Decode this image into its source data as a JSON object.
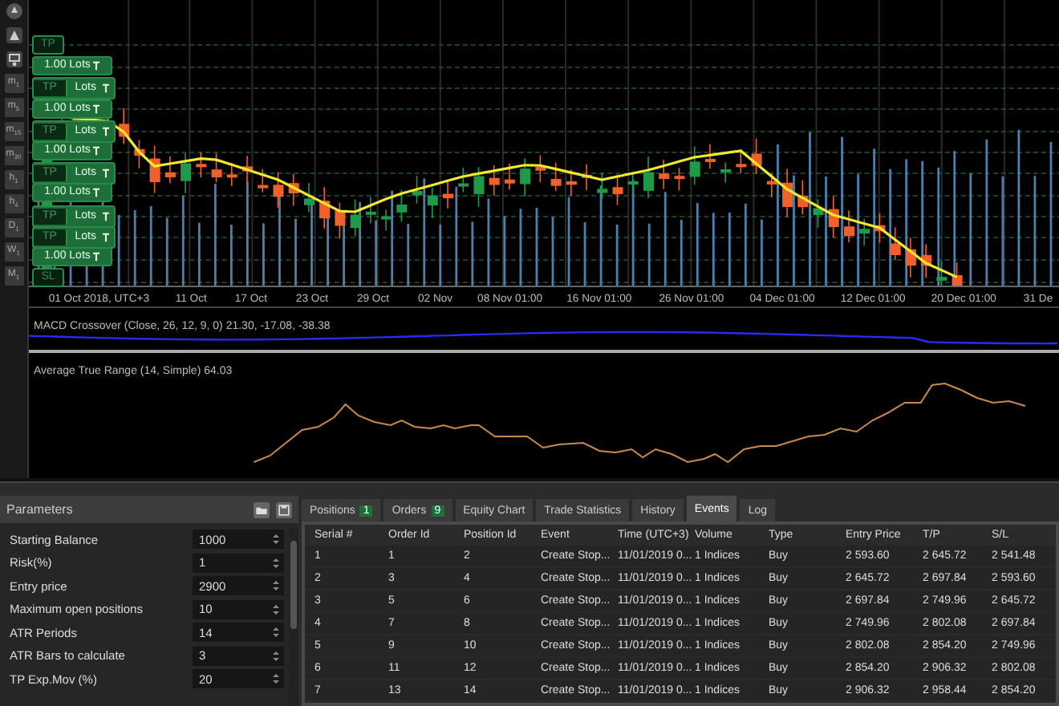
{
  "toolbar": {
    "timeframes": [
      {
        "letter": "m",
        "sub": "1"
      },
      {
        "letter": "m",
        "sub": "5"
      },
      {
        "letter": "m",
        "sub": "15"
      },
      {
        "letter": "m",
        "sub": "30"
      },
      {
        "letter": "h",
        "sub": "1"
      },
      {
        "letter": "h",
        "sub": "4"
      },
      {
        "letter": "D",
        "sub": "1"
      },
      {
        "letter": "W",
        "sub": "1"
      },
      {
        "letter": "M",
        "sub": "1"
      }
    ]
  },
  "order_tags": [
    {
      "kind": "tp",
      "text": "TP"
    },
    {
      "kind": "lots",
      "text": "1.00 Lots"
    },
    {
      "kind": "tp_over",
      "text": "TP",
      "tail": "Lots"
    },
    {
      "kind": "lots",
      "text": "1.00 Lots"
    },
    {
      "kind": "tp_over",
      "text": "TP",
      "tail": "Lots"
    },
    {
      "kind": "lots",
      "text": "1.00 Lots"
    },
    {
      "kind": "tp_over",
      "text": "TP",
      "tail": "Lots"
    },
    {
      "kind": "lots",
      "text": "1.00 Lots"
    },
    {
      "kind": "tp_over",
      "text": "TP",
      "tail": "Lots"
    },
    {
      "kind": "tp_over",
      "text": "TP",
      "tail": "Lots"
    },
    {
      "kind": "lots",
      "text": "1.00 Lots"
    },
    {
      "kind": "sl",
      "text": "SL"
    }
  ],
  "time_axis": [
    "01 Oct 2018, UTC+3",
    "11 Oct",
    "17 Oct",
    "23 Oct",
    "29 Oct",
    "02 Nov",
    "08 Nov 01:00",
    "16 Nov 01:00",
    "26 Nov 01:00",
    "04 Dec 01:00",
    "12 Dec 01:00",
    "20 Dec 01:00",
    "31 De"
  ],
  "macd": {
    "title": "MACD Crossover (Close, 26, 12, 9, 0) 21.30, -17.08, -38.38"
  },
  "atr": {
    "title": "Average True Range (14, Simple) 64.03"
  },
  "parameters": {
    "title": "Parameters",
    "rows": [
      {
        "label": "Starting Balance",
        "value": "1000"
      },
      {
        "label": "Risk(%)",
        "value": "1"
      },
      {
        "label": "Entry price",
        "value": "2900"
      },
      {
        "label": "Maximum open positions",
        "value": "10"
      },
      {
        "label": "ATR Periods",
        "value": "14"
      },
      {
        "label": "ATR Bars to calculate",
        "value": "3"
      },
      {
        "label": "TP Exp.Mov (%)",
        "value": "20"
      }
    ]
  },
  "tabs": [
    {
      "label": "Positions",
      "badge": "1",
      "selected": false
    },
    {
      "label": "Orders",
      "badge": "9",
      "selected": false
    },
    {
      "label": "Equity Chart",
      "selected": false
    },
    {
      "label": "Trade Statistics",
      "selected": false
    },
    {
      "label": "History",
      "selected": false
    },
    {
      "label": "Events",
      "selected": true
    },
    {
      "label": "Log",
      "selected": false
    }
  ],
  "table": {
    "columns": [
      "Serial #",
      "Order Id",
      "Position Id",
      "Event",
      "Time (UTC+3)",
      "Volume",
      "Type",
      "Entry Price",
      "T/P",
      "S/L"
    ],
    "rows": [
      [
        "1",
        "1",
        "2",
        "Create Stop...",
        "11/01/2019 0...",
        "1 Indices",
        "Buy",
        "2 593.60",
        "2 645.72",
        "2 541.48"
      ],
      [
        "2",
        "3",
        "4",
        "Create Stop...",
        "11/01/2019 0...",
        "1 Indices",
        "Buy",
        "2 645.72",
        "2 697.84",
        "2 593.60"
      ],
      [
        "3",
        "5",
        "6",
        "Create Stop...",
        "11/01/2019 0...",
        "1 Indices",
        "Buy",
        "2 697.84",
        "2 749.96",
        "2 645.72"
      ],
      [
        "4",
        "7",
        "8",
        "Create Stop...",
        "11/01/2019 0...",
        "1 Indices",
        "Buy",
        "2 749.96",
        "2 802.08",
        "2 697.84"
      ],
      [
        "5",
        "9",
        "10",
        "Create Stop...",
        "11/01/2019 0...",
        "1 Indices",
        "Buy",
        "2 802.08",
        "2 854.20",
        "2 749.96"
      ],
      [
        "6",
        "11",
        "12",
        "Create Stop...",
        "11/01/2019 0...",
        "1 Indices",
        "Buy",
        "2 854.20",
        "2 906.32",
        "2 802.08"
      ],
      [
        "7",
        "13",
        "14",
        "Create Stop...",
        "11/01/2019 0...",
        "1 Indices",
        "Buy",
        "2 906.32",
        "2 958.44",
        "2 854.20"
      ]
    ]
  }
}
